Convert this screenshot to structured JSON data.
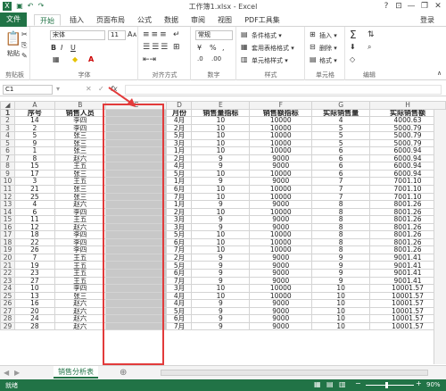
{
  "window": {
    "title": "工作簿1.xlsx - Excel",
    "minimize": "—",
    "restore": "❐",
    "close": "✕",
    "help": "?",
    "ribbon_opts": "⊡"
  },
  "tabs": [
    "文件",
    "开始",
    "插入",
    "页面布局",
    "公式",
    "数据",
    "审阅",
    "视图",
    "PDF工具集"
  ],
  "account": "登录",
  "ribbon": {
    "clipboard": {
      "paste": "粘贴",
      "label": "剪贴板"
    },
    "font": {
      "name": "宋体",
      "size": "11",
      "bold": "B",
      "italic": "I",
      "underline": "U",
      "grow": "A",
      "shrink": "A",
      "label": "字体"
    },
    "alignment": {
      "label": "对齐方式"
    },
    "number": {
      "format": "常规",
      "percent": "%",
      "comma": ",",
      "label": "数字"
    },
    "styles": {
      "conditional": "条件格式 ▾",
      "table": "套用表格格式 ▾",
      "cell": "单元格样式 ▾",
      "label": "样式"
    },
    "cells": {
      "insert": "插入 ▾",
      "delete": "删除 ▾",
      "format": "格式 ▾",
      "label": "单元格"
    },
    "editing": {
      "sum": "Σ",
      "label": "编辑"
    }
  },
  "formula_bar": {
    "name_box": "C1",
    "fx": "fx",
    "cancel": "✕",
    "enter": "✓",
    "value": ""
  },
  "columns": [
    "A",
    "B",
    "C",
    "D",
    "E",
    "F",
    "G",
    "H"
  ],
  "headers": [
    "序号",
    "销售人员",
    "",
    "月份",
    "销售量指标",
    "销售额指标",
    "实际销售量",
    "实际销售额"
  ],
  "rows": [
    [
      "14",
      "李四",
      "",
      "4月",
      "10",
      "10000",
      "4",
      "4000.63"
    ],
    [
      "2",
      "李四",
      "",
      "2月",
      "10",
      "10000",
      "5",
      "5000.79"
    ],
    [
      "5",
      "张三",
      "",
      "5月",
      "10",
      "10000",
      "5",
      "5000.79"
    ],
    [
      "9",
      "张三",
      "",
      "3月",
      "10",
      "10000",
      "5",
      "5000.79"
    ],
    [
      "1",
      "张三",
      "",
      "1月",
      "10",
      "10000",
      "6",
      "6000.94"
    ],
    [
      "8",
      "赵六",
      "",
      "2月",
      "9",
      "9000",
      "6",
      "6000.94"
    ],
    [
      "15",
      "王五",
      "",
      "4月",
      "9",
      "9000",
      "6",
      "6000.94"
    ],
    [
      "17",
      "张三",
      "",
      "5月",
      "10",
      "10000",
      "6",
      "6000.94"
    ],
    [
      "3",
      "王五",
      "",
      "1月",
      "9",
      "9000",
      "7",
      "7001.10"
    ],
    [
      "21",
      "张三",
      "",
      "6月",
      "10",
      "10000",
      "7",
      "7001.10"
    ],
    [
      "25",
      "张三",
      "",
      "7月",
      "10",
      "10000",
      "7",
      "7001.10"
    ],
    [
      "4",
      "赵六",
      "",
      "1月",
      "9",
      "9000",
      "8",
      "8001.26"
    ],
    [
      "6",
      "李四",
      "",
      "2月",
      "10",
      "10000",
      "8",
      "8001.26"
    ],
    [
      "11",
      "王五",
      "",
      "3月",
      "9",
      "9000",
      "8",
      "8001.26"
    ],
    [
      "12",
      "赵六",
      "",
      "3月",
      "9",
      "9000",
      "8",
      "8001.26"
    ],
    [
      "18",
      "李四",
      "",
      "5月",
      "10",
      "10000",
      "8",
      "8001.26"
    ],
    [
      "22",
      "李四",
      "",
      "6月",
      "10",
      "10000",
      "8",
      "8001.26"
    ],
    [
      "26",
      "李四",
      "",
      "7月",
      "10",
      "10000",
      "8",
      "8001.26"
    ],
    [
      "7",
      "王五",
      "",
      "2月",
      "9",
      "9000",
      "9",
      "9001.41"
    ],
    [
      "19",
      "王五",
      "",
      "5月",
      "9",
      "9000",
      "9",
      "9001.41"
    ],
    [
      "23",
      "王五",
      "",
      "6月",
      "9",
      "9000",
      "9",
      "9001.41"
    ],
    [
      "27",
      "王五",
      "",
      "7月",
      "9",
      "9000",
      "9",
      "9001.41"
    ],
    [
      "10",
      "李四",
      "",
      "3月",
      "10",
      "10000",
      "10",
      "10001.57"
    ],
    [
      "13",
      "张三",
      "",
      "4月",
      "10",
      "10000",
      "10",
      "10001.57"
    ],
    [
      "16",
      "赵六",
      "",
      "4月",
      "9",
      "9000",
      "10",
      "10001.57"
    ],
    [
      "20",
      "赵六",
      "",
      "5月",
      "9",
      "9000",
      "10",
      "10001.57"
    ],
    [
      "24",
      "赵六",
      "",
      "6月",
      "9",
      "9000",
      "10",
      "10001.57"
    ],
    [
      "28",
      "赵六",
      "",
      "7月",
      "9",
      "9000",
      "10",
      "10001.57"
    ]
  ],
  "sheet_tab": "销售分析表",
  "add_sheet": "⊕",
  "status": {
    "ready": "就绪",
    "zoom": "90%",
    "minus": "−",
    "plus": "+"
  },
  "colors": {
    "excel_green": "#217346",
    "highlight_red": "#e23b3b",
    "empty_column": "#c8c8c8"
  }
}
